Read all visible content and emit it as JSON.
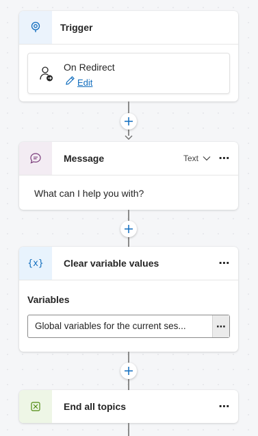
{
  "trigger": {
    "title": "Trigger",
    "event_label": "On Redirect",
    "edit_label": "Edit",
    "icon": "trigger-icon"
  },
  "message_node": {
    "title": "Message",
    "type_select": "Text",
    "body": "What can I help you with?",
    "icon": "message-icon",
    "more": "⋯"
  },
  "clear_vars_node": {
    "title": "Clear variable values",
    "icon_text": "{x}",
    "variables_label": "Variables",
    "variables_value": "Global variables for the current ses...",
    "more": "⋯",
    "field_more": "⋯"
  },
  "end_node": {
    "title": "End all topics",
    "icon": "end-topics-icon",
    "more": "⋯"
  },
  "colors": {
    "accent_blue": "#0f6cbd",
    "trigger_icon_bg": "#ebf3fc",
    "message_icon_bg": "#f3ecf3",
    "variable_icon_bg": "#e8f3fd",
    "end_icon_bg": "#eef6e6"
  }
}
